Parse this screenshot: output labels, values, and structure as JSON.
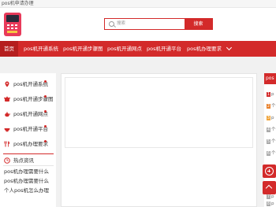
{
  "page": {
    "title": "pos机申请办理"
  },
  "search": {
    "placeholder": "搜索",
    "button_label": "搜索"
  },
  "nav": {
    "home": "首页",
    "items": [
      "pos机开通系统",
      "pos机开通步骤图",
      "pos机开通网点",
      "pos机开通平台",
      "pos机办理要求"
    ]
  },
  "sidebar": {
    "items": [
      {
        "label": "pos机开通系统",
        "icon": "location-pin-icon"
      },
      {
        "label": "pos机开通步骤图",
        "icon": "pot-icon"
      },
      {
        "label": "pos机开通网点",
        "icon": "teapot-icon"
      },
      {
        "label": "pos机开通平台",
        "icon": "bowl-icon"
      },
      {
        "label": "pos机办理要求",
        "icon": "utensils-icon"
      }
    ],
    "hot_title": "热点资讯",
    "hot_links": [
      "pos机办理需要什么",
      "pos机办理需要什么",
      "个人pos机怎么办理"
    ]
  },
  "rightpanel": {
    "head": "pos",
    "rows": [
      {
        "num": "1",
        "text": "p"
      },
      {
        "num": "2",
        "text": "个"
      },
      {
        "num": "3",
        "text": "p"
      },
      {
        "num": "4",
        "text": "个"
      },
      {
        "num": "5",
        "text": "个"
      },
      {
        "num": "6",
        "text": "个"
      },
      {
        "num": "7",
        "text": "p"
      },
      {
        "num": "8",
        "text": "p"
      }
    ]
  },
  "colors": {
    "brand": "#d32a2a",
    "accent_dark": "#b51e1e"
  }
}
